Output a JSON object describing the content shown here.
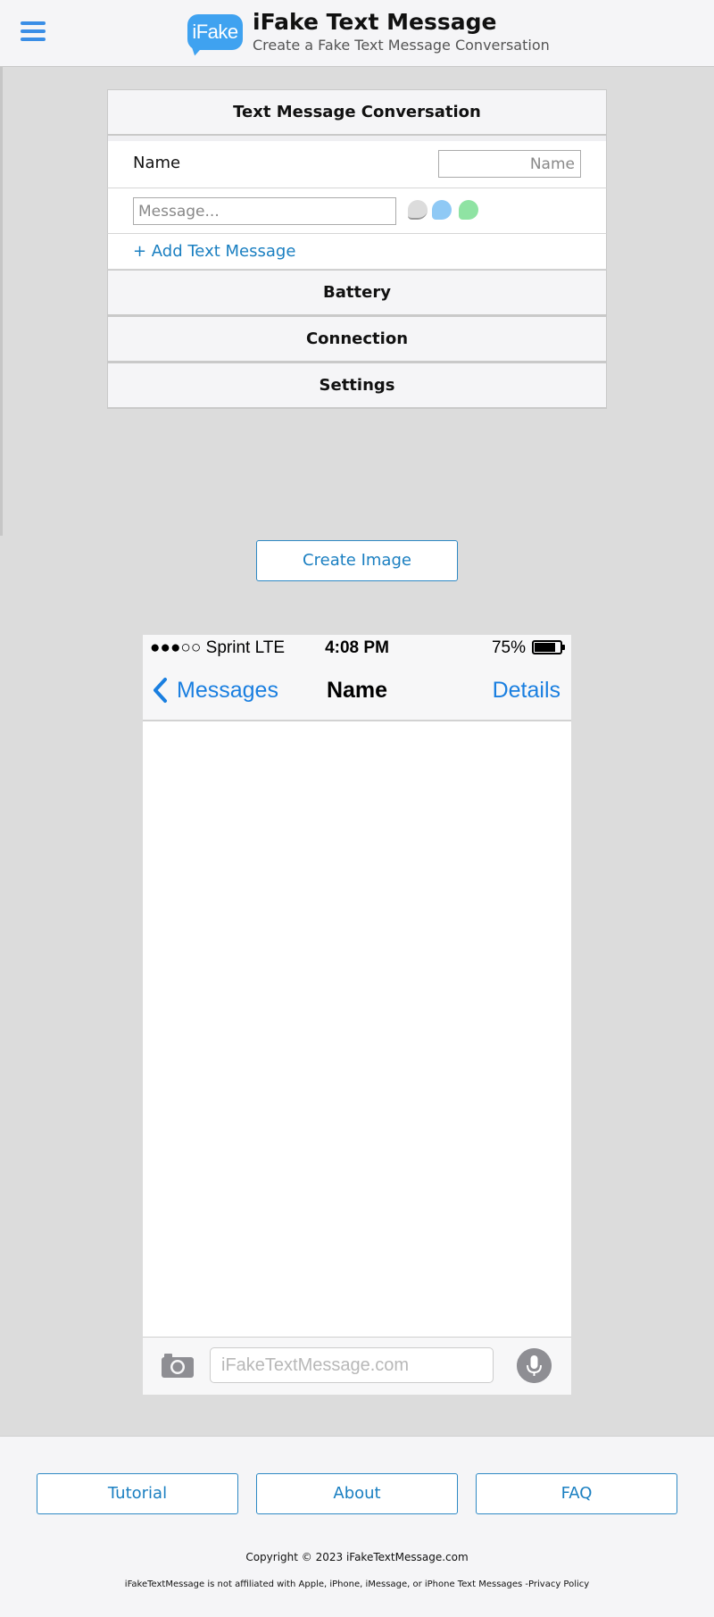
{
  "header": {
    "logo_text": "iFake",
    "title": "iFake Text Message",
    "subtitle": "Create a Fake Text Message Conversation"
  },
  "panel": {
    "conversation_title": "Text Message Conversation",
    "name_label": "Name",
    "name_placeholder": "Name",
    "message_placeholder": "Message...",
    "add_message": "+ Add Text Message",
    "sections": [
      "Battery",
      "Connection",
      "Settings"
    ]
  },
  "create_button": "Create Image",
  "phone": {
    "signal": "●●●○○ Sprint  LTE",
    "time": "4:08 PM",
    "battery": "75%",
    "battery_level": 0.75,
    "back_label": "Messages",
    "contact_name": "Name",
    "details_label": "Details",
    "input_placeholder": "iFakeTextMessage.com"
  },
  "footer": {
    "buttons": [
      "Tutorial",
      "About",
      "FAQ"
    ],
    "copyright": "Copyright © 2023 iFakeTextMessage.com",
    "disclaimer": "iFakeTextMessage is not affiliated with Apple, iPhone, iMessage, or iPhone Text Messages -",
    "privacy_link": "Privacy Policy"
  },
  "colors": {
    "accent": "#1a7fc1",
    "ios_blue": "#1a7fe0",
    "logo_blue": "#3fa2f0"
  }
}
